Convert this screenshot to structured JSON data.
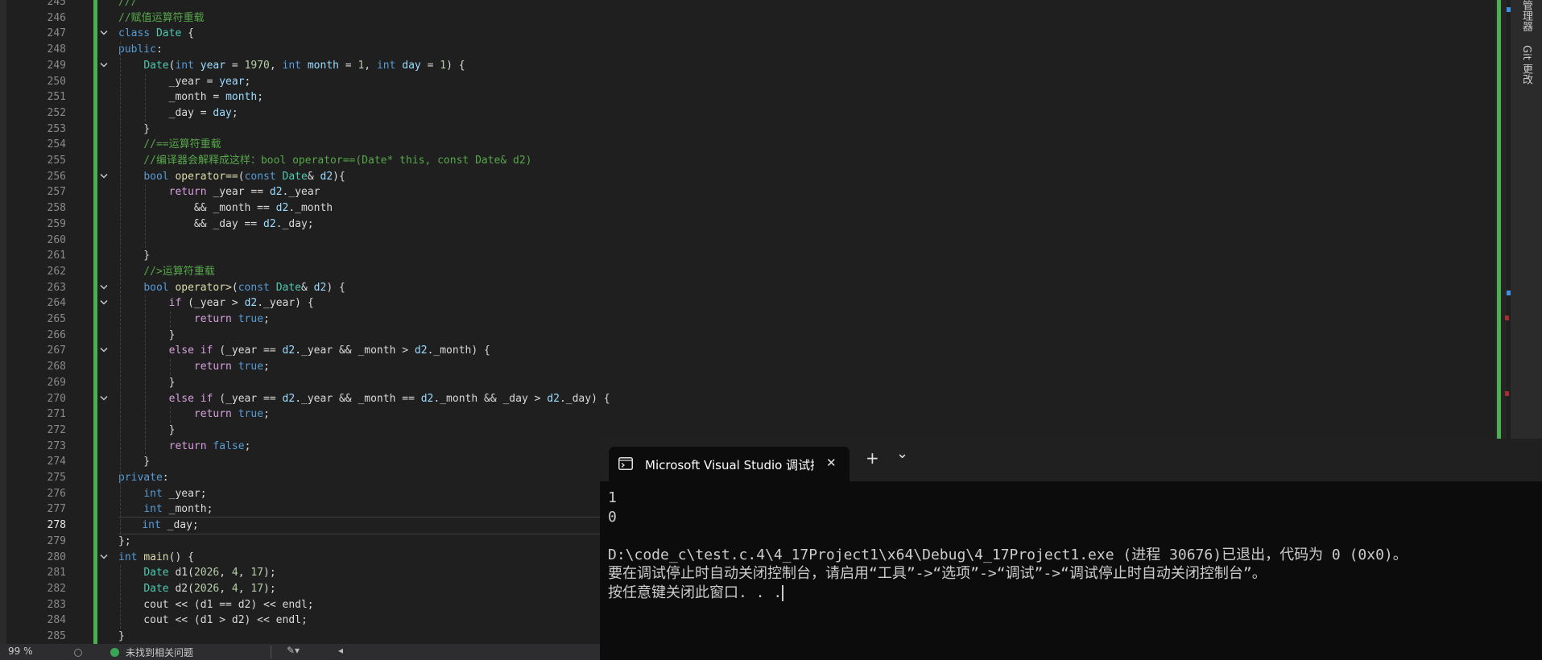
{
  "editor": {
    "line_numbers": [
      "245",
      "246",
      "247",
      "248",
      "249",
      "250",
      "251",
      "252",
      "253",
      "254",
      "255",
      "256",
      "257",
      "258",
      "259",
      "260",
      "261",
      "262",
      "263",
      "264",
      "265",
      "266",
      "267",
      "268",
      "269",
      "270",
      "271",
      "272",
      "273",
      "274",
      "275",
      "276",
      "277",
      "278",
      "279",
      "280",
      "281",
      "282",
      "283",
      "284",
      "285"
    ],
    "current_line": "278",
    "code_lines": [
      [
        [
          "cm",
          "///"
        ]
      ],
      [
        [
          "cm",
          "//赋值运算符重载"
        ]
      ],
      [
        [
          "kw",
          "class "
        ],
        [
          "ty",
          "Date"
        ],
        [
          "var",
          " {"
        ]
      ],
      [
        [
          "kw",
          "public"
        ],
        [
          "var",
          ":"
        ]
      ],
      [
        [
          "var",
          "    "
        ],
        [
          "ty",
          "Date"
        ],
        [
          "var",
          "("
        ],
        [
          "kw",
          "int "
        ],
        [
          "prm",
          "year"
        ],
        [
          "var",
          " = "
        ],
        [
          "num",
          "1970"
        ],
        [
          "var",
          ", "
        ],
        [
          "kw",
          "int "
        ],
        [
          "prm",
          "month"
        ],
        [
          "var",
          " = "
        ],
        [
          "num",
          "1"
        ],
        [
          "var",
          ", "
        ],
        [
          "kw",
          "int "
        ],
        [
          "prm",
          "day"
        ],
        [
          "var",
          " = "
        ],
        [
          "num",
          "1"
        ],
        [
          "var",
          ") {"
        ]
      ],
      [
        [
          "var",
          "        _year = "
        ],
        [
          "prm",
          "year"
        ],
        [
          "var",
          ";"
        ]
      ],
      [
        [
          "var",
          "        _month = "
        ],
        [
          "prm",
          "month"
        ],
        [
          "var",
          ";"
        ]
      ],
      [
        [
          "var",
          "        _day = "
        ],
        [
          "prm",
          "day"
        ],
        [
          "var",
          ";"
        ]
      ],
      [
        [
          "var",
          "    }"
        ]
      ],
      [
        [
          "cm",
          "    //==运算符重载"
        ]
      ],
      [
        [
          "cm",
          "    //编译器会解释成这样：bool operator==(Date* this, const Date& d2)"
        ]
      ],
      [
        [
          "var",
          "    "
        ],
        [
          "kw",
          "bool "
        ],
        [
          "fn",
          "operator=="
        ],
        [
          "var",
          "("
        ],
        [
          "kw",
          "const "
        ],
        [
          "ty",
          "Date"
        ],
        [
          "var",
          "& "
        ],
        [
          "prm",
          "d2"
        ],
        [
          "var",
          "){"
        ]
      ],
      [
        [
          "var",
          "        "
        ],
        [
          "ctl",
          "return "
        ],
        [
          "var",
          "_year == "
        ],
        [
          "prm",
          "d2"
        ],
        [
          "var",
          "._year"
        ]
      ],
      [
        [
          "var",
          "            && _month == "
        ],
        [
          "prm",
          "d2"
        ],
        [
          "var",
          "._month"
        ]
      ],
      [
        [
          "var",
          "            && _day == "
        ],
        [
          "prm",
          "d2"
        ],
        [
          "var",
          "._day;"
        ]
      ],
      [
        [
          "var",
          ""
        ]
      ],
      [
        [
          "var",
          "    }"
        ]
      ],
      [
        [
          "cm",
          "    //>运算符重载"
        ]
      ],
      [
        [
          "var",
          "    "
        ],
        [
          "kw",
          "bool "
        ],
        [
          "fn",
          "operator>"
        ],
        [
          "var",
          "("
        ],
        [
          "kw",
          "const "
        ],
        [
          "ty",
          "Date"
        ],
        [
          "var",
          "& "
        ],
        [
          "prm",
          "d2"
        ],
        [
          "var",
          ") {"
        ]
      ],
      [
        [
          "var",
          "        "
        ],
        [
          "ctl",
          "if "
        ],
        [
          "var",
          "(_year > "
        ],
        [
          "prm",
          "d2"
        ],
        [
          "var",
          "._year) {"
        ]
      ],
      [
        [
          "var",
          "            "
        ],
        [
          "ctl",
          "return "
        ],
        [
          "kw",
          "true"
        ],
        [
          "var",
          ";"
        ]
      ],
      [
        [
          "var",
          "        }"
        ]
      ],
      [
        [
          "var",
          "        "
        ],
        [
          "ctl",
          "else if "
        ],
        [
          "var",
          "(_year == "
        ],
        [
          "prm",
          "d2"
        ],
        [
          "var",
          "._year && _month > "
        ],
        [
          "prm",
          "d2"
        ],
        [
          "var",
          "._month) {"
        ]
      ],
      [
        [
          "var",
          "            "
        ],
        [
          "ctl",
          "return "
        ],
        [
          "kw",
          "true"
        ],
        [
          "var",
          ";"
        ]
      ],
      [
        [
          "var",
          "        }"
        ]
      ],
      [
        [
          "var",
          "        "
        ],
        [
          "ctl",
          "else if "
        ],
        [
          "var",
          "(_year == "
        ],
        [
          "prm",
          "d2"
        ],
        [
          "var",
          "._year && _month == "
        ],
        [
          "prm",
          "d2"
        ],
        [
          "var",
          "._month && _day > "
        ],
        [
          "prm",
          "d2"
        ],
        [
          "var",
          "._day) {"
        ]
      ],
      [
        [
          "var",
          "            "
        ],
        [
          "ctl",
          "return "
        ],
        [
          "kw",
          "true"
        ],
        [
          "var",
          ";"
        ]
      ],
      [
        [
          "var",
          "        }"
        ]
      ],
      [
        [
          "var",
          "        "
        ],
        [
          "ctl",
          "return "
        ],
        [
          "kw",
          "false"
        ],
        [
          "var",
          ";"
        ]
      ],
      [
        [
          "var",
          "    }"
        ]
      ],
      [
        [
          "kw",
          "private"
        ],
        [
          "var",
          ":"
        ]
      ],
      [
        [
          "var",
          "    "
        ],
        [
          "kw",
          "int "
        ],
        [
          "var",
          "_year;"
        ]
      ],
      [
        [
          "var",
          "    "
        ],
        [
          "kw",
          "int "
        ],
        [
          "var",
          "_month;"
        ]
      ],
      [
        [
          "var",
          "    "
        ],
        [
          "kw",
          "int "
        ],
        [
          "var",
          "_day;"
        ]
      ],
      [
        [
          "var",
          "};"
        ]
      ],
      [
        [
          "kw",
          "int "
        ],
        [
          "fn",
          "main"
        ],
        [
          "var",
          "() {"
        ]
      ],
      [
        [
          "var",
          "    "
        ],
        [
          "ty",
          "Date "
        ],
        [
          "var",
          "d1("
        ],
        [
          "num",
          "2026"
        ],
        [
          "var",
          ", "
        ],
        [
          "num",
          "4"
        ],
        [
          "var",
          ", "
        ],
        [
          "num",
          "17"
        ],
        [
          "var",
          ");"
        ]
      ],
      [
        [
          "var",
          "    "
        ],
        [
          "ty",
          "Date "
        ],
        [
          "var",
          "d2("
        ],
        [
          "num",
          "2026"
        ],
        [
          "var",
          ", "
        ],
        [
          "num",
          "4"
        ],
        [
          "var",
          ", "
        ],
        [
          "num",
          "17"
        ],
        [
          "var",
          ");"
        ]
      ],
      [
        [
          "var",
          "    cout << (d1 == d2) << endl;"
        ]
      ],
      [
        [
          "var",
          "    cout << (d1 > d2) << endl;"
        ]
      ],
      [
        [
          "var",
          "}"
        ]
      ]
    ],
    "fold_lines": [
      "247",
      "249",
      "256",
      "263",
      "264",
      "267",
      "270",
      "280"
    ]
  },
  "side_panel": {
    "tab1": "管理器",
    "tab2": "Git 更改"
  },
  "statusbar": {
    "zoom": "99 %",
    "issues": "未找到相关问题"
  },
  "console": {
    "tab_title": "Microsoft Visual Studio 调试控",
    "new_tab": "+",
    "dropdown": "⌄",
    "close": "✕",
    "output_lines": [
      "1",
      "0",
      "",
      "D:\\code_c\\test.c.4\\4_17Project1\\x64\\Debug\\4_17Project1.exe (进程 30676)已退出，代码为 0 (0x0)。",
      "要在调试停止时自动关闭控制台，请启用“工具”->“选项”->“调试”->“调试停止时自动关闭控制台”。",
      "按任意键关闭此窗口. . ."
    ]
  },
  "colors": {
    "editor_bg": "#1f1f1f",
    "console_bg": "#0c0c0c",
    "change_bar": "#4caf50",
    "keyword": "#569cd6",
    "type": "#4ec9b0",
    "comment": "#57a64a",
    "control": "#d8a0df"
  }
}
